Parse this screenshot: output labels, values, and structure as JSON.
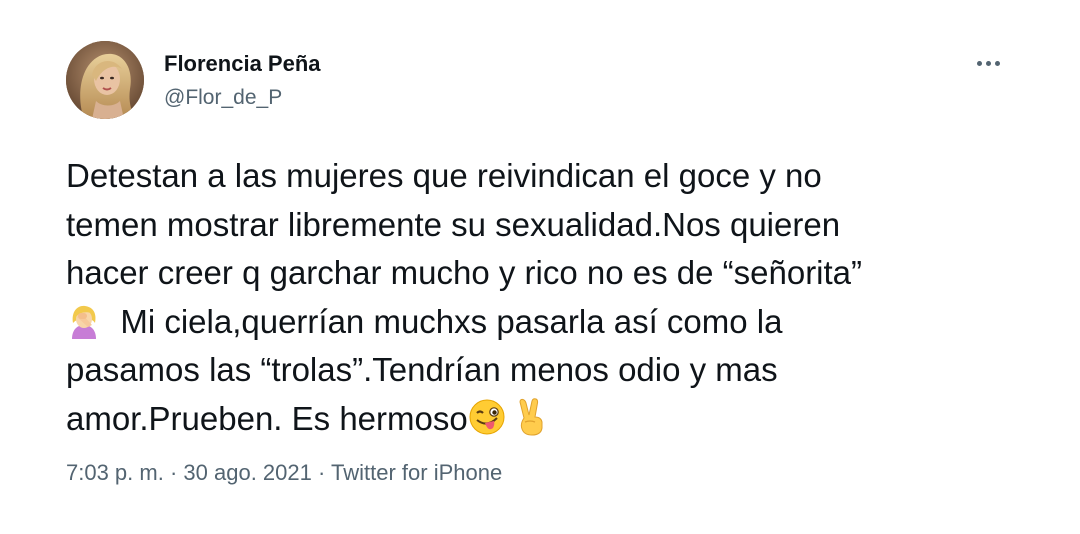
{
  "author": {
    "display_name": "Florencia Peña",
    "handle": "@Flor_de_P"
  },
  "tweet": {
    "lines": {
      "l1": "Detestan a las mujeres que reivindican el goce y no",
      "l2": "temen mostrar libremente su sexualidad.Nos quieren",
      "l3": "hacer creer q garchar mucho y rico no es de “señorita”",
      "l4": "Mi ciela,querrían muchxs pasarla así como la",
      "l5": "pasamos las “trolas”.Tendrían menos odio y mas",
      "l6": "amor.Prueben. Es hermoso"
    },
    "emojis": [
      "woman-facepalming-icon",
      "winking-face-with-tongue-icon",
      "victory-hand-icon"
    ]
  },
  "meta": {
    "time": "7:03 p. m.",
    "sep1": " · ",
    "date": "30 ago. 2021",
    "sep2": " · ",
    "source": "Twitter for iPhone"
  },
  "colors": {
    "text": "#0f1419",
    "secondary": "#536471",
    "background": "#ffffff"
  }
}
